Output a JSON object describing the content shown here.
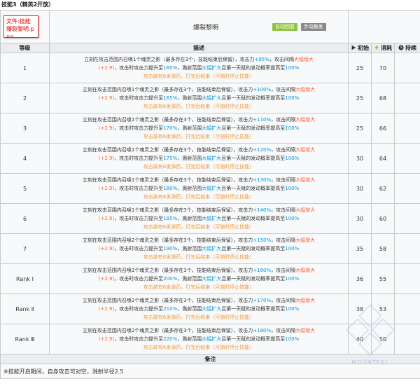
{
  "section_title": "技能3（精英2开放）",
  "skill": {
    "icon_label": "文件:技能 爆裂黎明.png",
    "name": "爆裂黎明",
    "tags": [
      "自动回复",
      "手动触发"
    ]
  },
  "columns": {
    "level": "等级",
    "description": "描述",
    "initial": "初始",
    "cost": "消耗",
    "duration": "持续"
  },
  "icons": {
    "initial": "play-triangle-icon",
    "cost": "lightning-bolt-icon",
    "duration": "clock-icon"
  },
  "colors": {
    "highlight_blue": "#0098dc",
    "highlight_red": "#ff6237",
    "note_orange": "#f09a3e",
    "tag_green": "#8cc63f",
    "tag_gray": "#888888"
  },
  "rows": [
    {
      "level": "1",
      "count": "1",
      "atk": "+95%",
      "burst": "160%",
      "initial": "25",
      "cost": "70"
    },
    {
      "level": "2",
      "count": "1",
      "atk": "+100%",
      "burst": "165%",
      "initial": "25",
      "cost": "68"
    },
    {
      "level": "3",
      "count": "1",
      "atk": "+110%",
      "burst": "170%",
      "initial": "25",
      "cost": "66"
    },
    {
      "level": "4",
      "count": "1",
      "atk": "+120%",
      "burst": "175%",
      "initial": "30",
      "cost": "64"
    },
    {
      "level": "5",
      "count": "1",
      "atk": "+130%",
      "burst": "180%",
      "initial": "30",
      "cost": "62"
    },
    {
      "level": "6",
      "count": "1",
      "atk": "+140%",
      "burst": "185%",
      "initial": "30",
      "cost": "60"
    },
    {
      "level": "7",
      "count": "2",
      "atk": "+150%",
      "burst": "190%",
      "initial": "35",
      "cost": "58"
    },
    {
      "level": "Rank Ⅰ",
      "count": "2",
      "atk": "+160%",
      "burst": "200%",
      "initial": "36",
      "cost": "55"
    },
    {
      "level": "Rank Ⅱ",
      "count": "2",
      "atk": "+170%",
      "burst": "210%",
      "initial": "38",
      "cost": "53"
    },
    {
      "level": "Rank Ⅲ",
      "count": "2",
      "atk": "+180%",
      "burst": "220%",
      "initial": "40",
      "cost": "50"
    }
  ],
  "desc_parts": {
    "p1": "立刻在攻击范围内召唤",
    "p2": "个魂灵之影（最多存在3个，技能结束后保留），攻击力",
    "p3": "，攻击间隔",
    "interval_big": "大幅增大",
    "interval_val": "(+2.9)",
    "p4": "，攻击时攻击力提升至",
    "p5": "，溅射范围",
    "splash_big": "大幅扩大",
    "p6": "且第一天赋的发动概率提高至",
    "talent_rate": "100%",
    "ammo_line": "攻击装有6发弹药，打完后结束（可随时停止技能）"
  },
  "notes": {
    "header": "备注",
    "text": "※技能开启期间，自身攻击可对空，溅射半径2.5"
  },
  "watermark": "MOONTEAL"
}
